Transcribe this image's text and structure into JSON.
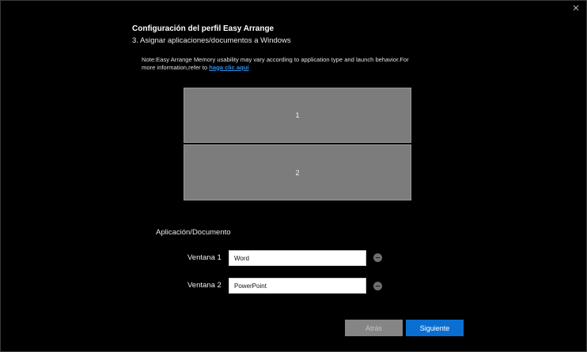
{
  "dialog": {
    "title": "Configuración del perfil Easy Arrange",
    "step": "3. Asignar aplicaciones/documentos a Windows"
  },
  "note": {
    "text": "Note:Easy Arrange Memory usability may vary according to application type and launch behavior.For more information,refer to ",
    "link_label": "haga clic aquí"
  },
  "layout_preview": {
    "zones": [
      {
        "label": "1"
      },
      {
        "label": "2"
      }
    ]
  },
  "assignments": {
    "section_label": "Aplicación/Documento",
    "rows": [
      {
        "label": "Ventana 1",
        "value": "Word"
      },
      {
        "label": "Ventana 2",
        "value": "PowerPoint"
      }
    ]
  },
  "footer": {
    "back_label": "Atrás",
    "next_label": "Siguiente"
  },
  "colors": {
    "background": "#000000",
    "zone_fill": "#7c7c7c",
    "link": "#2f8fe6",
    "primary_button": "#0a6fd1",
    "disabled_button": "#858585"
  },
  "icons": {
    "close": "close-icon",
    "remove": "minus-circle-icon"
  }
}
